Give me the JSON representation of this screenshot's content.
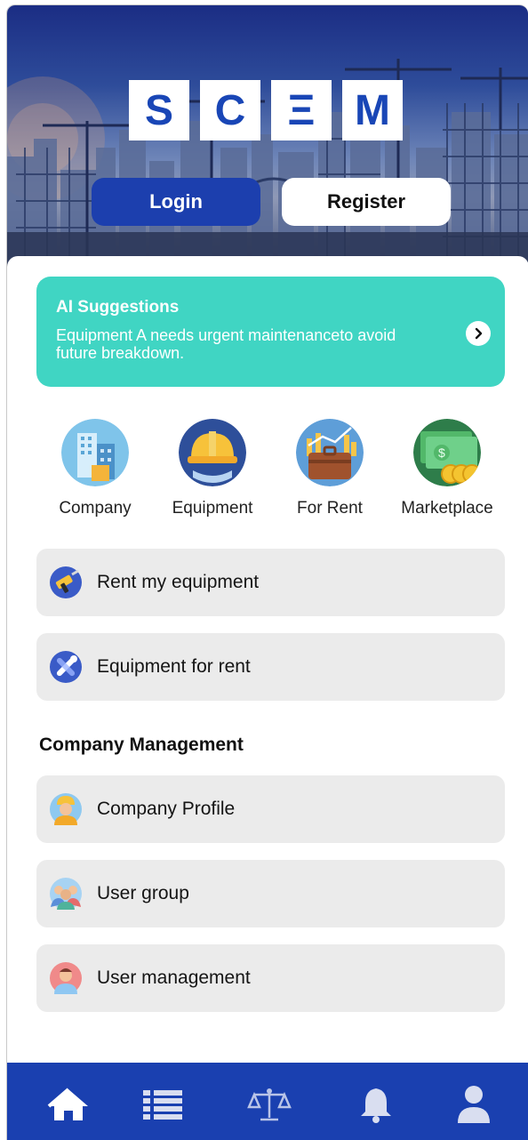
{
  "app": {
    "logo_letters": [
      "S",
      "C",
      "Ξ",
      "M"
    ]
  },
  "auth": {
    "login_label": "Login",
    "register_label": "Register"
  },
  "ai_suggestion": {
    "title": "AI Suggestions",
    "message": "Equipment A needs urgent maintenanceto avoid future breakdown.",
    "arrow_icon": "chevron-right-icon"
  },
  "categories": [
    {
      "label": "Company",
      "icon": "building-icon"
    },
    {
      "label": "Equipment",
      "icon": "hard-hat-icon"
    },
    {
      "label": "For Rent",
      "icon": "briefcase-chart-icon"
    },
    {
      "label": "Marketplace",
      "icon": "money-coins-icon"
    }
  ],
  "equipment_actions": [
    {
      "label": "Rent my equipment",
      "icon": "drill-icon"
    },
    {
      "label": "Equipment for rent",
      "icon": "tools-icon"
    }
  ],
  "company_management": {
    "title": "Company Management",
    "items": [
      {
        "label": "Company Profile",
        "icon": "worker-avatar-icon"
      },
      {
        "label": "User group",
        "icon": "user-group-icon"
      },
      {
        "label": "User management",
        "icon": "user-avatar-icon"
      }
    ]
  },
  "bottom_nav": [
    {
      "name": "home",
      "icon": "home-icon"
    },
    {
      "name": "list",
      "icon": "list-icon"
    },
    {
      "name": "legal",
      "icon": "scales-icon"
    },
    {
      "name": "notifications",
      "icon": "bell-icon"
    },
    {
      "name": "profile",
      "icon": "user-icon"
    }
  ],
  "colors": {
    "primary": "#1C3FAE",
    "nav_bar": "#1A40B0",
    "ai_card": "#40D5C3",
    "list_bg": "#EBEBEB"
  }
}
